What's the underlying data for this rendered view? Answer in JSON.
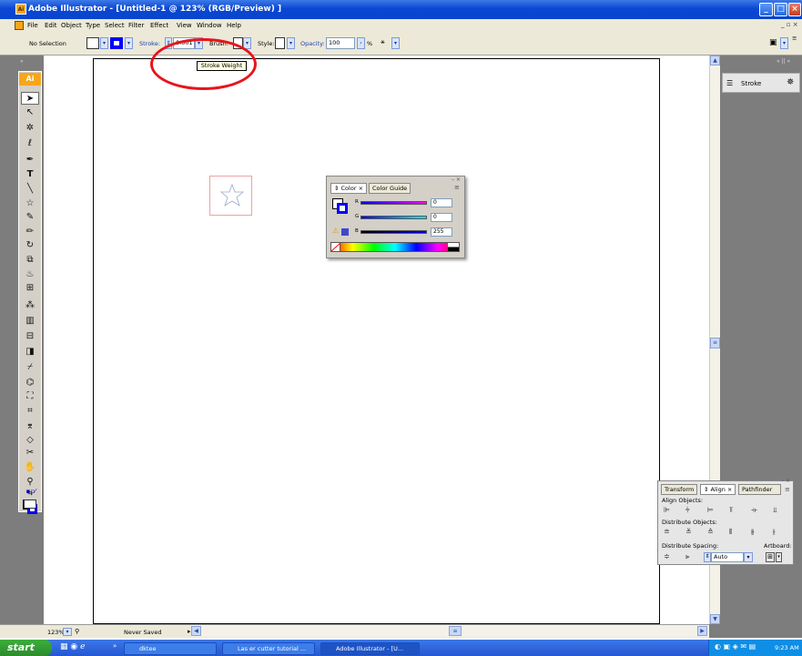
{
  "window": {
    "title": "Adobe Illustrator - [Untitled-1 @ 123% (RGB/Preview) ]",
    "app_icon": "Ai"
  },
  "menu": [
    "File",
    "Edit",
    "Object",
    "Type",
    "Select",
    "Filter",
    "Effect",
    "View",
    "Window",
    "Help"
  ],
  "control": {
    "selection": "No Selection",
    "stroke_label": "Stroke:",
    "stroke_value": "0.001",
    "brush_label": "Brush:",
    "style_label": "Style:",
    "opacity_label": "Opacity:",
    "opacity_value": "100",
    "percent": "%"
  },
  "tooltip": "Stroke Weight",
  "toolbox": {
    "badge": "Ai"
  },
  "panels": {
    "stroke_tab": "Stroke",
    "color": {
      "tab1": "Color",
      "tab2": "Color Guide",
      "r_label": "R",
      "g_label": "G",
      "b_label": "B",
      "r_value": "0",
      "g_value": "0",
      "b_value": "255"
    },
    "align": {
      "tab1": "Transform",
      "tab2": "Align",
      "tab3": "Pathfinder",
      "align_objects": "Align Objects:",
      "distribute_objects": "Distribute Objects:",
      "distribute_spacing": "Distribute Spacing:",
      "artboard": "Artboard:",
      "spacing_value": "Auto"
    }
  },
  "status": {
    "zoom": "123%",
    "saved": "Never Saved"
  },
  "taskbar": {
    "start": "start",
    "tasks": [
      "dktee",
      "Las er cutter tutorial ...",
      "Adobe Illustrator - [U..."
    ],
    "clock": "9:23 AM"
  },
  "colors": {
    "title_blue": "#0a47d4",
    "highlight_red": "#e8141b",
    "panel_gray": "#7d7d7d",
    "ui_beige": "#ece9d8",
    "fill_blue": "#0000ff"
  }
}
